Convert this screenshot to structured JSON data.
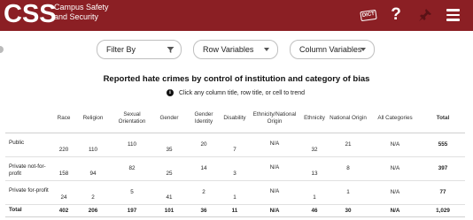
{
  "header": {
    "logo": "CSS",
    "app_title_line1": "Campus Safety",
    "app_title_line2": "and Security",
    "dict_label": "DICT",
    "help_glyph": "?",
    "icons": [
      "dictionary-icon",
      "help-icon",
      "pin-icon",
      "menu-icon"
    ]
  },
  "controls": {
    "filter_label": "Filter By",
    "row_label": "Row Variables",
    "column_label": "Column Variables"
  },
  "title": "Reported hate crimes by control of institution and category of bias",
  "hint": "Click any column title, row title, or cell to trend",
  "table": {
    "columns": [
      "Race",
      "Religion",
      "Sexual Orientation",
      "Gender",
      "Gender Identity",
      "Disability",
      "Ethnicity/National Origin",
      "Ethnicity",
      "National Origin",
      "All Categories",
      "Total"
    ],
    "rows": [
      {
        "label": "Public",
        "cells": [
          "220",
          "110",
          "110",
          "35",
          "20",
          "7",
          "N/A",
          "32",
          "21",
          "N/A",
          "555"
        ]
      },
      {
        "label": "Private not-for-profit",
        "cells": [
          "158",
          "94",
          "82",
          "25",
          "14",
          "3",
          "N/A",
          "13",
          "8",
          "N/A",
          "397"
        ]
      },
      {
        "label": "Private for-profit",
        "cells": [
          "24",
          "2",
          "5",
          "41",
          "2",
          "1",
          "N/A",
          "1",
          "1",
          "N/A",
          "77"
        ]
      }
    ],
    "total_row": {
      "label": "Total",
      "cells": [
        "402",
        "206",
        "197",
        "101",
        "36",
        "11",
        "N/A",
        "46",
        "30",
        "N/A",
        "1,029"
      ]
    }
  },
  "colors": {
    "header_bg": "#8b1f24",
    "header_text": "#ffffff"
  }
}
